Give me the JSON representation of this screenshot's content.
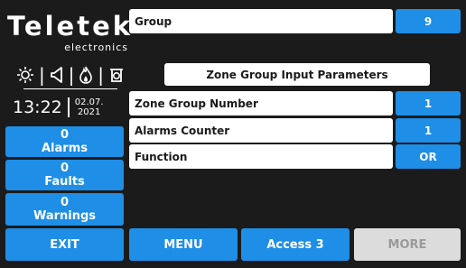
{
  "branding": {
    "logo": "Teletek",
    "sub": "electronics"
  },
  "status_icons": [
    "sun-icon",
    "speaker-icon",
    "flame-icon",
    "bell-icon"
  ],
  "clock": {
    "time": "13:22",
    "date_line1": "02.07.",
    "date_line2": "2021"
  },
  "counters": [
    {
      "value": "0",
      "label": "Alarms"
    },
    {
      "value": "0",
      "label": "Faults"
    },
    {
      "value": "0",
      "label": "Warnings"
    }
  ],
  "header": {
    "label": "Group",
    "value": "9"
  },
  "section_title": "Zone Group Input Parameters",
  "params": [
    {
      "label": "Zone Group Number",
      "value": "1"
    },
    {
      "label": "Alarms Counter",
      "value": "1"
    },
    {
      "label": "Function",
      "value": "OR"
    }
  ],
  "bottom": {
    "exit": "EXIT",
    "menu": "MENU",
    "access": "Access 3",
    "more": "MORE"
  },
  "colors": {
    "accent": "#1e8ee6",
    "background": "#1b1b1b",
    "disabled": "#dcdcdc"
  }
}
